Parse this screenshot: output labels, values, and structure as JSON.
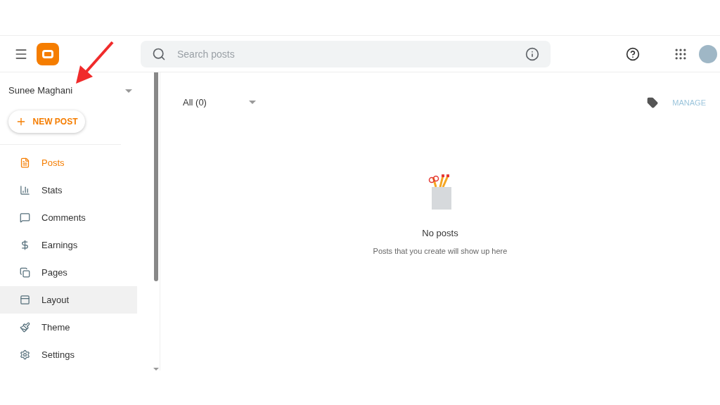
{
  "header": {
    "search": {
      "placeholder": "Search posts"
    }
  },
  "sidebar": {
    "blog_name": "Sunee Maghani",
    "new_post": "NEW POST",
    "items": [
      {
        "kind": "posts",
        "label": "Posts",
        "selected": true,
        "hovered": false
      },
      {
        "kind": "stats",
        "label": "Stats",
        "selected": false,
        "hovered": false
      },
      {
        "kind": "comments",
        "label": "Comments",
        "selected": false,
        "hovered": false
      },
      {
        "kind": "earnings",
        "label": "Earnings",
        "selected": false,
        "hovered": false
      },
      {
        "kind": "pages",
        "label": "Pages",
        "selected": false,
        "hovered": false
      },
      {
        "kind": "layout",
        "label": "Layout",
        "selected": false,
        "hovered": true
      },
      {
        "kind": "theme",
        "label": "Theme",
        "selected": false,
        "hovered": false
      },
      {
        "kind": "settings",
        "label": "Settings",
        "selected": false,
        "hovered": false
      }
    ]
  },
  "main": {
    "filter": "All (0)",
    "manage": "MANAGE",
    "empty_title": "No posts",
    "empty_text": "Posts that you create will show up here"
  }
}
